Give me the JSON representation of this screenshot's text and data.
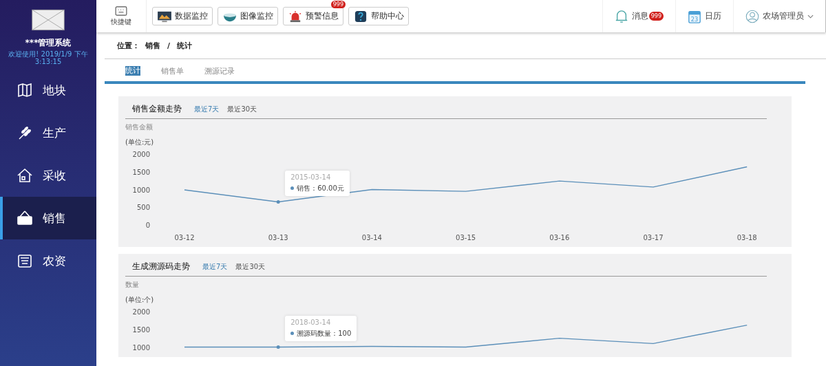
{
  "sidebar": {
    "title": "***管理系统",
    "welcome": "欢迎使用! 2019/1/9 下午3:13:15",
    "items": [
      {
        "label": "地块",
        "selected": false
      },
      {
        "label": "生产",
        "selected": false
      },
      {
        "label": "采收",
        "selected": false
      },
      {
        "label": "销售",
        "selected": true
      },
      {
        "label": "农资",
        "selected": false
      }
    ]
  },
  "toolbar": {
    "shortcut": "快捷键",
    "buttons": [
      {
        "label": "数据监控"
      },
      {
        "label": "图像监控"
      },
      {
        "label": "预警信息",
        "badge": "999"
      },
      {
        "label": "帮助中心"
      }
    ],
    "right": [
      {
        "kind": "notify",
        "label": "消息",
        "badge": "999"
      },
      {
        "kind": "calendar",
        "label": "日历",
        "day": "23"
      },
      {
        "kind": "user",
        "label": "农场管理员"
      }
    ]
  },
  "breadcrumb": {
    "prefix": "位置：",
    "items": [
      "销售",
      "统计"
    ],
    "separator": "/"
  },
  "tabs": [
    {
      "label": "统计",
      "selected": true
    },
    {
      "label": "销售单",
      "selected": false
    },
    {
      "label": "溯源记录",
      "selected": false
    }
  ],
  "panels": [
    {
      "title": "销售金额走势",
      "ranges": [
        {
          "label": "最近7天",
          "selected": true
        },
        {
          "label": "最近30天",
          "selected": false
        }
      ],
      "series_label": "销售金额",
      "unit": "(单位:元)",
      "tooltip": {
        "date": "2015-03-14",
        "value": "：60.00元"
      },
      "chart_data": {
        "type": "line",
        "categories": [
          "03-12",
          "03-13",
          "03-14",
          "03-15",
          "03-16",
          "03-17",
          "03-18"
        ],
        "ylim": [
          0,
          2000
        ],
        "yticks": [
          0,
          500,
          1000,
          1500,
          2000
        ],
        "series": [
          {
            "name": "销售",
            "color": "#5b8fb9",
            "values": [
              990,
              650,
              1000,
              950,
              1240,
              1070,
              1640
            ]
          }
        ]
      }
    },
    {
      "title": "生成溯源码走势",
      "ranges": [
        {
          "label": "最近7天",
          "selected": true
        },
        {
          "label": "最近30天",
          "selected": false
        }
      ],
      "series_label": "数量",
      "unit": "(单位:个)",
      "tooltip": {
        "date": "2018-03-14",
        "value": "：100"
      },
      "chart_data": {
        "type": "line",
        "ylim": [
          1000,
          2000
        ],
        "yticks": [
          1000,
          1500,
          2000
        ],
        "series": [
          {
            "name": "溯源码数量",
            "color": "#5b8fb9",
            "values": [
              1000,
              1000,
              1020,
              1000,
              1250,
              1100,
              1620
            ]
          }
        ]
      }
    }
  ]
}
